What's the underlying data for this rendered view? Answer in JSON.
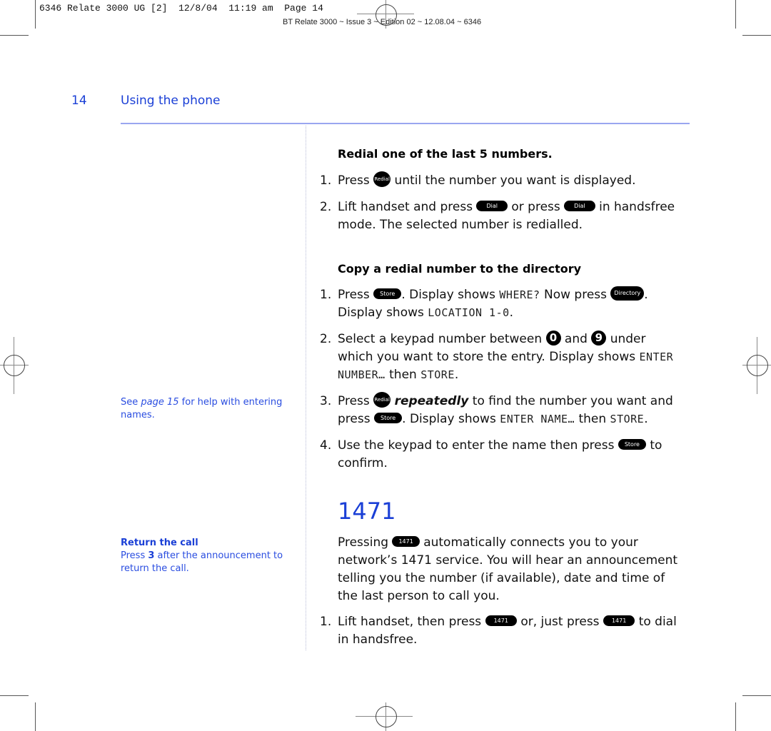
{
  "slug": {
    "line1": "6346 Relate 3000 UG [2]  12/8/04  11:19 am  Page 14",
    "line2": "BT Relate 3000 ~ Issue 3 ~ Edition 02 ~ 12.08.04 ~ 6346"
  },
  "header": {
    "page_number": "14",
    "section_title": "Using the phone"
  },
  "colors": {
    "accent": "#1a3fd6",
    "sidebar_text": "#2a4de0",
    "rule": "#9aa6f0"
  },
  "sidebar": {
    "note1": {
      "prefix": "See ",
      "link": "page 15",
      "suffix": " for help with entering names."
    },
    "note2": {
      "title": "Return the call",
      "prefix": "Press ",
      "key": "3",
      "suffix": " after the announcement to return the call."
    }
  },
  "keys": {
    "redial": "Redial",
    "dial": "Dial",
    "store": "Store",
    "directory": "Directory",
    "k1471": "1471",
    "zero": "0",
    "nine": "9"
  },
  "section1": {
    "heading": "Redial one of the last 5 numbers.",
    "steps": [
      {
        "n": "1.",
        "a": "Press ",
        "b": " until the number you want is displayed."
      },
      {
        "n": "2.",
        "a": "Lift handset and press ",
        "b": " or press ",
        "c": " in handsfree mode. The selected number is redialled."
      }
    ]
  },
  "section2": {
    "heading": "Copy a redial number to the directory",
    "steps": [
      {
        "n": "1.",
        "a": "Press ",
        "b": ". Display shows ",
        "lcd1": "WHERE?",
        "c": " Now press ",
        "d": ". Display shows ",
        "lcd2": "LOCATION 1-0",
        "e": "."
      },
      {
        "n": "2.",
        "a": "Select a keypad number between ",
        "b": " and ",
        "c": " under which you want to store the entry. Display shows ",
        "lcd1": "ENTER NUMBER…",
        "d": " then ",
        "lcd2": "STORE",
        "e": "."
      },
      {
        "n": "3.",
        "a": "Press ",
        "em": "repeatedly",
        "b": " to find the number you want and press ",
        "c": ". Display shows ",
        "lcd1": "ENTER NAME…",
        "d": " then ",
        "lcd2": "STORE",
        "e": "."
      },
      {
        "n": "4.",
        "a": "Use the keypad to enter the name then press ",
        "b": " to confirm."
      }
    ]
  },
  "section3": {
    "heading": "1471",
    "intro_a": "Pressing ",
    "intro_b": " automatically connects you to your network’s 1471 service. You will hear an announcement telling you the number (if available), date and time of the last person to call you.",
    "steps": [
      {
        "n": "1.",
        "a": "Lift handset, then press ",
        "b": " or, just press ",
        "c": " to dial in handsfree."
      }
    ]
  }
}
